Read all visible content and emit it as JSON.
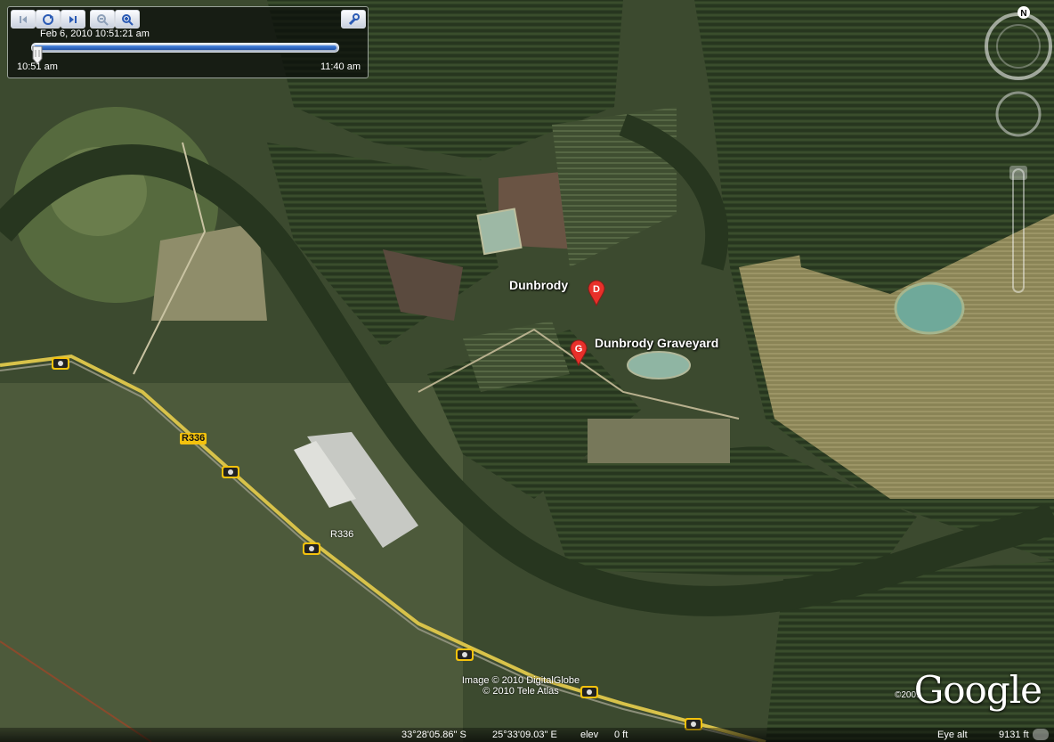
{
  "time": {
    "date": "Feb  6, 2010  10:51:21 am",
    "start": "10:51 am",
    "end": "11:40 am",
    "progress": 1.0
  },
  "toolbar": {
    "buttons": [
      "step-back-icon",
      "play-icon",
      "step-forward-icon",
      "zoom-out-icon",
      "zoom-in-icon",
      "wrench-icon"
    ]
  },
  "nav": {
    "north": "N"
  },
  "places": [
    {
      "letter": "D",
      "name": "Dunbrody"
    },
    {
      "letter": "G",
      "name": "Dunbrody Graveyard"
    }
  ],
  "roads": {
    "shield": "R336",
    "label": "R336"
  },
  "attribution": {
    "line1": "Image © 2010 DigitalGlobe",
    "line2": "© 2010 Tele Atlas"
  },
  "logo": {
    "text": "Google",
    "year": "©2009"
  },
  "status": {
    "lat": "33°28'05.86\" S",
    "lon": "25°33'09.03\" E",
    "elev_label": "elev",
    "elev": "0 ft",
    "eye_label": "Eye alt",
    "eye": "9131 ft"
  },
  "colors": {
    "pin": "#e8302a",
    "road": "#f4c20d",
    "water": "#6fa99a"
  }
}
